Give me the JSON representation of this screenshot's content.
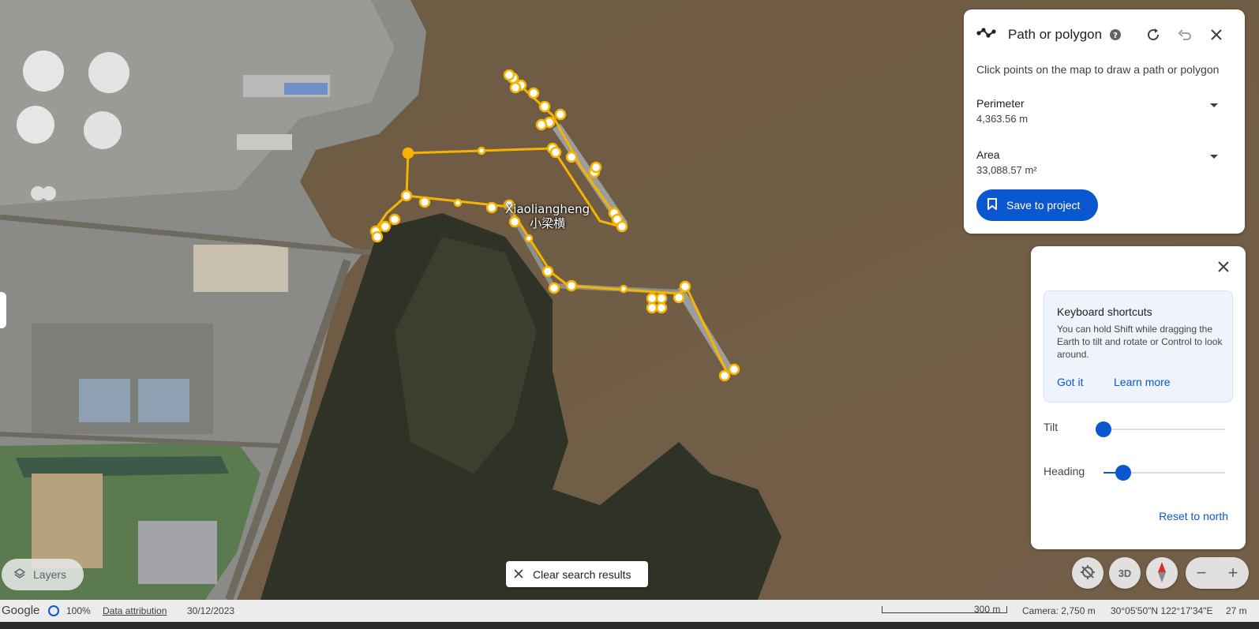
{
  "map": {
    "place_label_en": "Xiaoliangheng",
    "place_label_zh": "小梁横"
  },
  "path_panel": {
    "title": "Path or polygon",
    "hint": "Click points on the map to draw a path or polygon",
    "perimeter_label": "Perimeter",
    "perimeter_value": "4,363.56 m",
    "area_label": "Area",
    "area_value": "33,088.57 m²",
    "save_label": "Save to project",
    "icons": [
      "path-icon",
      "help-icon",
      "refresh-icon",
      "undo-icon",
      "close-icon"
    ]
  },
  "shortcuts_panel": {
    "tip_title": "Keyboard shortcuts",
    "tip_text": "You can hold Shift while dragging the Earth to tilt and rotate or Control to look around.",
    "got_it": "Got it",
    "learn_more": "Learn more",
    "tilt_label": "Tilt",
    "tilt_fraction": 0.0,
    "heading_label": "Heading",
    "heading_fraction": 0.16,
    "reset_label": "Reset to north"
  },
  "controls": {
    "layers_label": "Layers",
    "clear_search_label": "Clear search results",
    "btn_3d_label": "3D",
    "zoom_out": "−",
    "zoom_in": "+"
  },
  "status_bar": {
    "brand": "Google",
    "progress": "100%",
    "attribution": "Data attribution",
    "date": "30/12/2023",
    "scale": "300 m",
    "camera": "Camera: 2,750 m",
    "coords": "30°05'50\"N 122°17'34\"E",
    "elevation": "27 m"
  },
  "colors": {
    "accent": "#0b57d0",
    "path": "#f5b400",
    "water": "#6b5a44"
  }
}
